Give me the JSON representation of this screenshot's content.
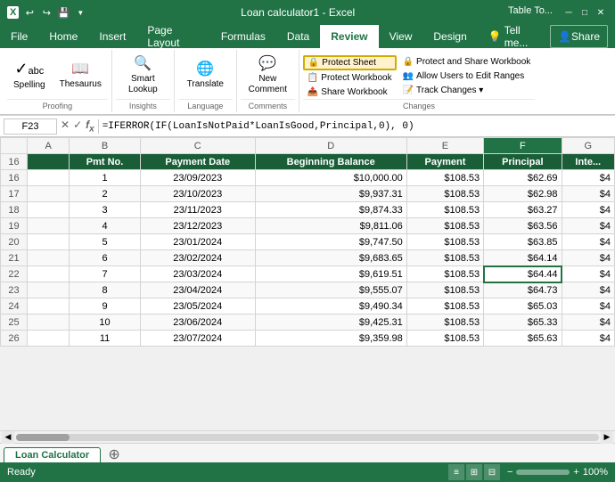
{
  "titleBar": {
    "title": "Loan calculator1 - Excel",
    "rightTitle": "Table To...",
    "quickAccess": [
      "↩",
      "↪",
      "💾"
    ]
  },
  "ribbonTabs": [
    "File",
    "Home",
    "Insert",
    "Page Layout",
    "Formulas",
    "Data",
    "Review",
    "View",
    "Design",
    "Tell me..."
  ],
  "activeTab": "Review",
  "ribbonGroups": {
    "proofing": {
      "label": "Proofing",
      "buttons": [
        {
          "icon": "✓abc",
          "text": "Spelling"
        },
        {
          "icon": "📖",
          "text": "Thesaurus"
        }
      ]
    },
    "insights": {
      "label": "Insights",
      "buttons": [
        {
          "icon": "🔍",
          "text": "Smart Lookup"
        }
      ]
    },
    "language": {
      "label": "Language",
      "buttons": [
        {
          "icon": "🌐",
          "text": "Translate"
        }
      ]
    },
    "comments": {
      "label": "Comments",
      "buttons": [
        {
          "icon": "💬",
          "text": "New Comment"
        }
      ]
    },
    "changes": {
      "label": "Changes",
      "items1": [
        "Protect Sheet",
        "Protect Workbook",
        "Share Workbook"
      ],
      "items2": [
        "Protect and Share Workbook",
        "Allow Users to Edit Ranges",
        "Track Changes"
      ]
    }
  },
  "formulaBar": {
    "nameBox": "F23",
    "formula": "=IFERROR(IF(LoanIsNotPaid*LoanIsGood,Principal,0), 0)"
  },
  "columnHeaders": [
    "A",
    "B",
    "C",
    "D",
    "E",
    "F",
    "G"
  ],
  "activeCol": "F",
  "tableHeaders": {
    "B": "Pmt No.",
    "C": "Payment Date",
    "D": "Beginning Balance",
    "E": "Payment",
    "F": "Principal",
    "G": "Inte..."
  },
  "rows": [
    {
      "rowNum": 16,
      "cells": {
        "B": "1",
        "C": "23/09/2023",
        "D": "$10,000.00",
        "E": "$108.53",
        "F": "$62.69",
        "G": "$4"
      }
    },
    {
      "rowNum": 17,
      "cells": {
        "B": "2",
        "C": "23/10/2023",
        "D": "$9,937.31",
        "E": "$108.53",
        "F": "$62.98",
        "G": "$4"
      }
    },
    {
      "rowNum": 18,
      "cells": {
        "B": "3",
        "C": "23/11/2023",
        "D": "$9,874.33",
        "E": "$108.53",
        "F": "$63.27",
        "G": "$4"
      }
    },
    {
      "rowNum": 19,
      "cells": {
        "B": "4",
        "C": "23/12/2023",
        "D": "$9,811.06",
        "E": "$108.53",
        "F": "$63.56",
        "G": "$4"
      }
    },
    {
      "rowNum": 20,
      "cells": {
        "B": "5",
        "C": "23/01/2024",
        "D": "$9,747.50",
        "E": "$108.53",
        "F": "$63.85",
        "G": "$4"
      }
    },
    {
      "rowNum": 21,
      "cells": {
        "B": "6",
        "C": "23/02/2024",
        "D": "$9,683.65",
        "E": "$108.53",
        "F": "$64.14",
        "G": "$4"
      }
    },
    {
      "rowNum": 22,
      "cells": {
        "B": "7",
        "C": "23/03/2024",
        "D": "$9,619.51",
        "E": "$108.53",
        "F": "$64.44",
        "G": "$4"
      },
      "active": true
    },
    {
      "rowNum": 23,
      "cells": {
        "B": "8",
        "C": "23/04/2024",
        "D": "$9,555.07",
        "E": "$108.53",
        "F": "$64.73",
        "G": "$4"
      }
    },
    {
      "rowNum": 24,
      "cells": {
        "B": "9",
        "C": "23/05/2024",
        "D": "$9,490.34",
        "E": "$108.53",
        "F": "$65.03",
        "G": "$4"
      }
    },
    {
      "rowNum": 25,
      "cells": {
        "B": "10",
        "C": "23/06/2024",
        "D": "$9,425.31",
        "E": "$108.53",
        "F": "$65.33",
        "G": "$4"
      }
    },
    {
      "rowNum": 26,
      "cells": {
        "B": "11",
        "C": "23/07/2024",
        "D": "$9,359.98",
        "E": "$108.53",
        "F": "$65.63",
        "G": "$4"
      }
    }
  ],
  "sheetTabs": [
    "Loan Calculator"
  ],
  "activeSheet": "Loan Calculator",
  "statusBar": {
    "status": "Ready",
    "zoom": "100%"
  },
  "changesLabels": {
    "protectSheet": "Protect Sheet",
    "protectWorkbook": "Protect Workbook",
    "shareWorkbook": "Share Workbook",
    "protectAndShare": "Protect and Share Workbook",
    "allowUsers": "Allow Users to Edit Ranges",
    "trackChanges": "Track Changes ▾"
  }
}
